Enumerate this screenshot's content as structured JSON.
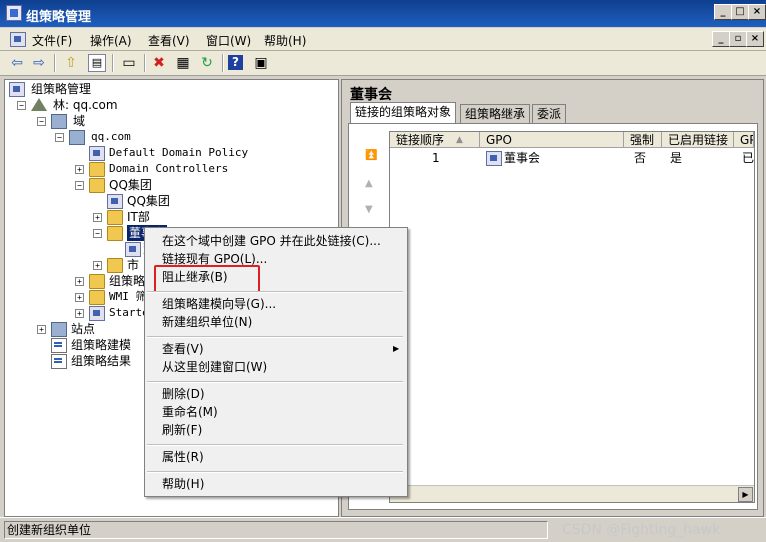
{
  "window": {
    "title": "组策略管理"
  },
  "menu": {
    "items": [
      "文件(F)",
      "操作(A)",
      "查看(V)",
      "窗口(W)",
      "帮助(H)"
    ]
  },
  "tree": {
    "root": "组策略管理",
    "forest": "林: qq.com",
    "domains": "域",
    "domain": "qq.com",
    "default_policy": "Default Domain Policy",
    "domain_controllers": "Domain Controllers",
    "ou_qq": "QQ集团",
    "gpo_qq": "QQ集团",
    "ou_it": "IT部",
    "ou_board": "董事会",
    "gpo_board_partial": "董",
    "ou_market": "市",
    "gpo_objects": "组策略",
    "wmi_filters": "WMI 筛",
    "starter_gpos": "Starte",
    "sites": "站点",
    "modeling": "组策略建模",
    "results": "组策略结果"
  },
  "right": {
    "title": "董事会",
    "tabs": [
      "链接的组策略对象",
      "组策略继承",
      "委派"
    ],
    "columns": [
      "链接顺序",
      "GPO",
      "强制",
      "已启用链接",
      "GP"
    ],
    "rows": [
      {
        "order": "1",
        "gpo": "董事会",
        "enforced": "否",
        "enabled": "是",
        "gp": "已"
      }
    ]
  },
  "context_menu": {
    "create_link": "在这个域中创建 GPO 并在此处链接(C)...",
    "link_existing": "链接现有 GPO(L)...",
    "block_inheritance": "阻止继承(B)",
    "modeling_wizard": "组策略建模向导(G)...",
    "new_ou": "新建组织单位(N)",
    "view": "查看(V)",
    "new_window": "从这里创建窗口(W)",
    "delete": "删除(D)",
    "rename": "重命名(M)",
    "refresh": "刷新(F)",
    "properties": "属性(R)",
    "help": "帮助(H)"
  },
  "status": {
    "text": "创建新组织单位"
  },
  "watermark": "CSDN @Fighting_hawk"
}
